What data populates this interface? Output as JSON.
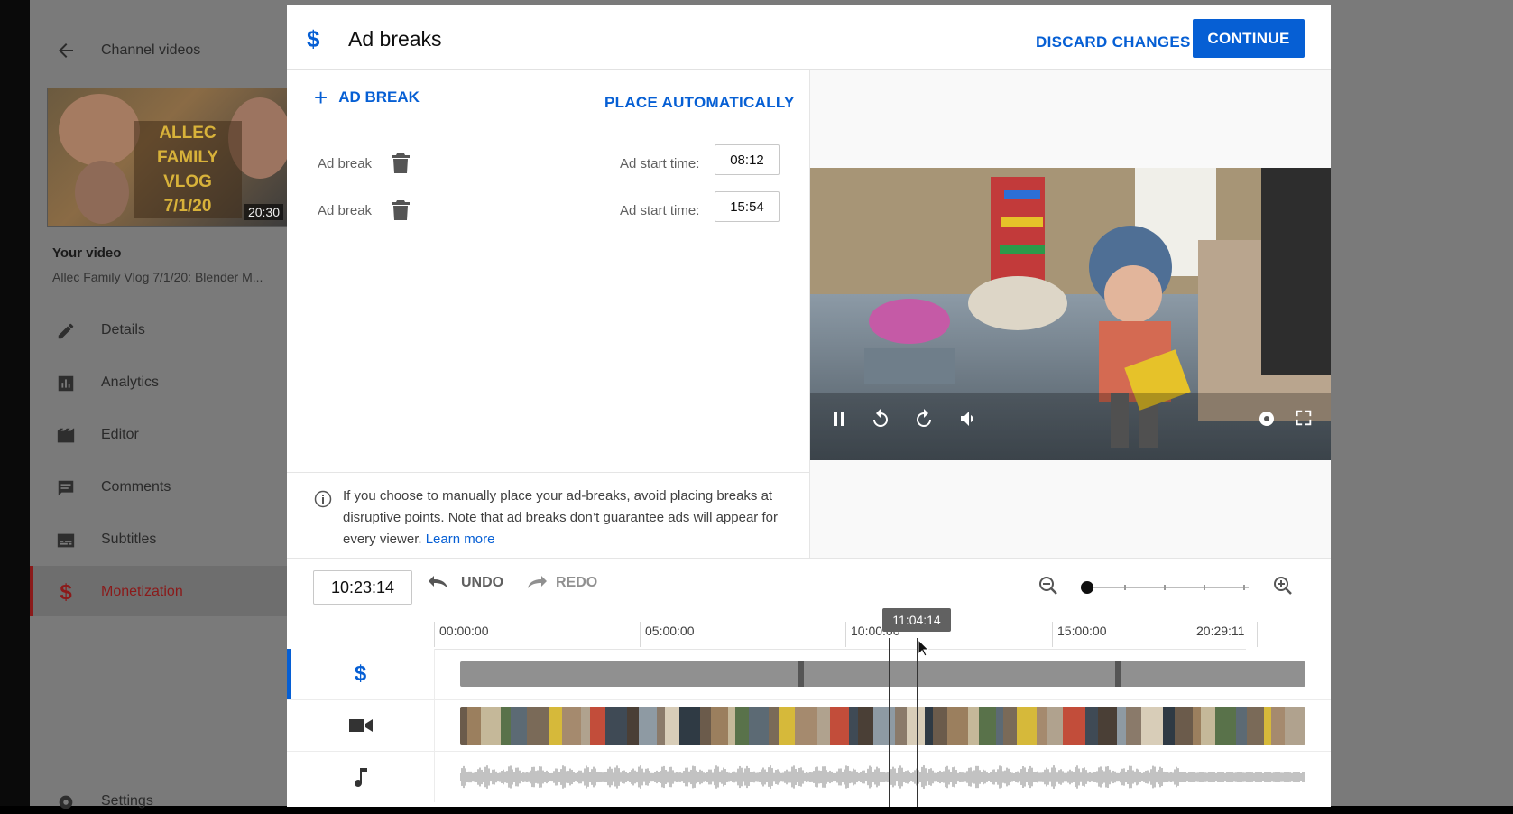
{
  "sidebar": {
    "back_label": "Channel videos",
    "thumbnail": {
      "title_lines": [
        "ALLEC",
        "FAMILY VLOG",
        "7/1/20"
      ],
      "duration": "20:30"
    },
    "your_video_heading": "Your video",
    "video_title": "Allec Family Vlog 7/1/20: Blender M...",
    "items": [
      {
        "label": "Details",
        "icon": "pencil-icon"
      },
      {
        "label": "Analytics",
        "icon": "bar-chart-icon"
      },
      {
        "label": "Editor",
        "icon": "clapperboard-icon"
      },
      {
        "label": "Comments",
        "icon": "comment-icon"
      },
      {
        "label": "Subtitles",
        "icon": "subtitles-icon"
      },
      {
        "label": "Monetization",
        "icon": "dollar-icon",
        "active": true
      },
      {
        "label": "Settings",
        "icon": "gear-icon"
      }
    ]
  },
  "dialog": {
    "title": "Ad breaks",
    "discard_label": "DISCARD CHANGES",
    "continue_label": "CONTINUE",
    "add_break_label": "AD BREAK",
    "place_auto_label": "PLACE AUTOMATICALLY",
    "breaks": [
      {
        "label": "Ad break",
        "start_label": "Ad start time:",
        "start_time": "08:12"
      },
      {
        "label": "Ad break",
        "start_label": "Ad start time:",
        "start_time": "15:54"
      }
    ],
    "info_text": "If you choose to manually place your ad-breaks, avoid placing breaks at disruptive points. Note that ad breaks don’t guarantee ads will appear for every viewer.",
    "learn_more": "Learn more"
  },
  "timeline": {
    "current_time": "10:23:14",
    "undo_label": "UNDO",
    "redo_label": "REDO",
    "ruler_labels": [
      "00:00:00",
      "05:00:00",
      "10:00:00",
      "15:00:00",
      "20:29:11"
    ],
    "hover_time": "11:04:14"
  },
  "colors": {
    "accent": "#065fd4",
    "active_side": "#8b1a1a"
  }
}
